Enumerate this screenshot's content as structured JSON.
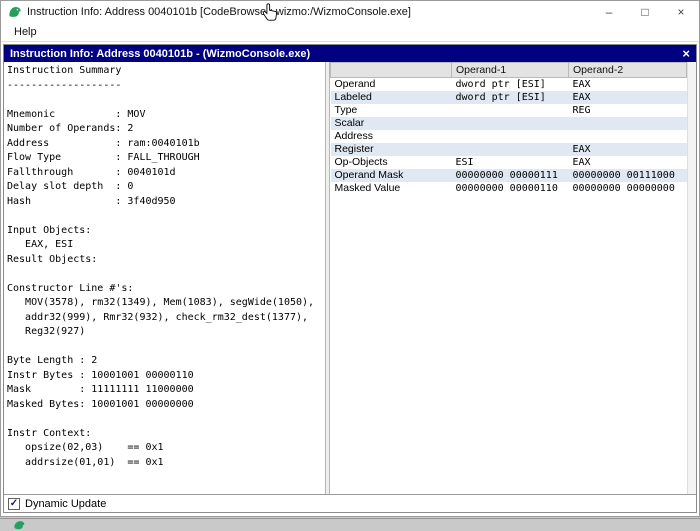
{
  "window": {
    "title": "Instruction Info: Address 0040101b [CodeBrowser: wizmo:/WizmoConsole.exe]",
    "controls": {
      "minimize": "–",
      "maximize": "□",
      "close": "×"
    }
  },
  "menu": {
    "items": [
      "Help"
    ]
  },
  "dialog": {
    "title": "Instruction Info: Address 0040101b - (WizmoConsole.exe)",
    "close_glyph": "×"
  },
  "summary": {
    "lines": [
      "Instruction Summary",
      "-------------------",
      "",
      "Mnemonic          : MOV",
      "Number of Operands: 2",
      "Address           : ram:0040101b",
      "Flow Type         : FALL_THROUGH",
      "Fallthrough       : 0040101d",
      "Delay slot depth  : 0",
      "Hash              : 3f40d950",
      "",
      "Input Objects:",
      "   EAX, ESI",
      "Result Objects:",
      "",
      "Constructor Line #'s:",
      "   MOV(3578), rm32(1349), Mem(1083), segWide(1050),",
      "   addr32(999), Rmr32(932), check_rm32_dest(1377),",
      "   Reg32(927)",
      "",
      "Byte Length : 2",
      "Instr Bytes : 10001001 00000110",
      "Mask        : 11111111 11000000",
      "Masked Bytes: 10001001 00000000",
      "",
      "Instr Context:",
      "   opsize(02,03)    == 0x1",
      "   addrsize(01,01)  == 0x1"
    ]
  },
  "table": {
    "headers": [
      "",
      "Operand-1",
      "Operand-2"
    ],
    "rows": [
      [
        "Operand",
        "dword ptr [ESI]",
        "EAX"
      ],
      [
        "Labeled",
        "dword ptr [ESI]",
        "EAX"
      ],
      [
        "Type",
        "",
        "REG"
      ],
      [
        "Scalar",
        "",
        ""
      ],
      [
        "Address",
        "",
        ""
      ],
      [
        "Register",
        "",
        "EAX"
      ],
      [
        "Op-Objects",
        "ESI",
        "EAX"
      ],
      [
        "Operand Mask",
        "00000000 00000111",
        "00000000 00111000"
      ],
      [
        "Masked Value",
        "00000000 00000110",
        "00000000 00000000"
      ]
    ]
  },
  "footer": {
    "dynamic_update_label": "Dynamic Update",
    "checked": true,
    "check_glyph": "✓"
  },
  "colors": {
    "dialog_titlebar": "#000080",
    "row_stripe": "#dfe8f3",
    "table_header_bg": "#e3e3e3",
    "app_icon_green": "#27a05f"
  }
}
